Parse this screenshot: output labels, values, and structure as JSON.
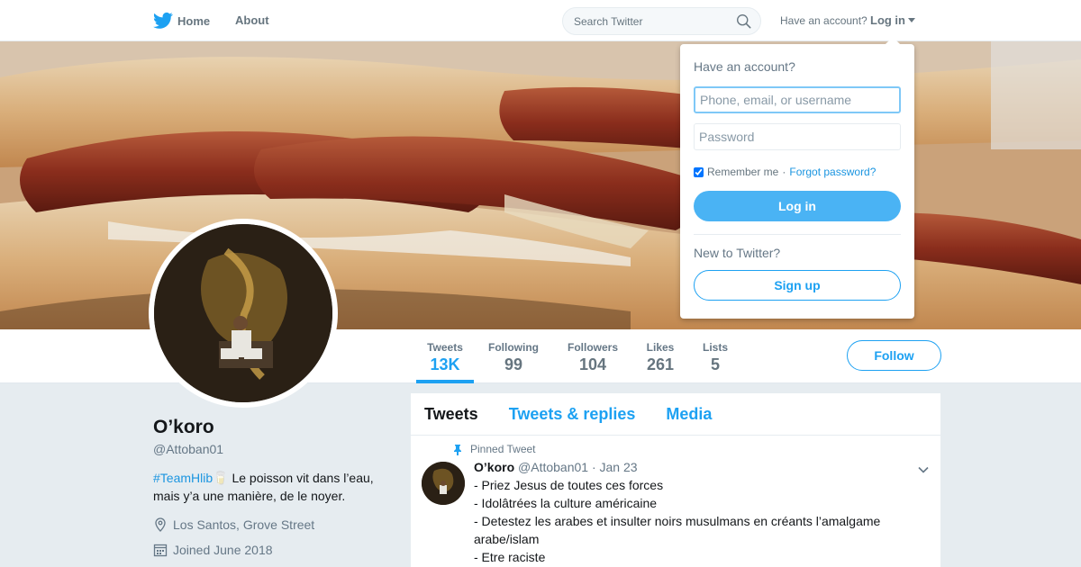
{
  "nav": {
    "home_label": "Home",
    "about_label": "About",
    "search_placeholder": "Search Twitter",
    "have_account_text": "Have an account?",
    "login_label": "Log in"
  },
  "colors": {
    "accent": "#1da1f2",
    "login_button": "#4ab3f4",
    "background": "#e6ecf0"
  },
  "profile": {
    "name": "O’koro",
    "handle": "@Attoban01",
    "bio_hashtag": "#TeamHlib",
    "bio_emoji": "🥛",
    "bio_text": " Le poisson vit dans l’eau, mais y’a une manière, de le noyer.",
    "location": "Los Santos, Grove Street",
    "joined": "Joined June 2018",
    "follow_label": "Follow"
  },
  "stats": [
    {
      "label": "Tweets",
      "value": "13K"
    },
    {
      "label": "Following",
      "value": "99"
    },
    {
      "label": "Followers",
      "value": "104"
    },
    {
      "label": "Likes",
      "value": "261"
    },
    {
      "label": "Lists",
      "value": "5"
    }
  ],
  "timeline": {
    "tabs": [
      "Tweets",
      "Tweets & replies",
      "Media"
    ],
    "pinned_label": "Pinned Tweet",
    "tweet": {
      "author": "O’koro",
      "handle": "@Attoban01",
      "date": "· Jan 23",
      "lines": [
        "- Priez Jesus de toutes ces forces",
        "- Idolâtrées la culture américaine",
        "- Detestez les arabes et insulter noirs musulmans en créants l’amalgame arabe/islam",
        "- Etre raciste"
      ]
    }
  },
  "login_dropdown": {
    "title": "Have an account?",
    "username_placeholder": "Phone, email, or username",
    "password_placeholder": "Password",
    "remember_label": "Remember me",
    "separator": " · ",
    "forgot_label": "Forgot password?",
    "login_button": "Log in",
    "new_text": "New to Twitter?",
    "signup_button": "Sign up"
  }
}
